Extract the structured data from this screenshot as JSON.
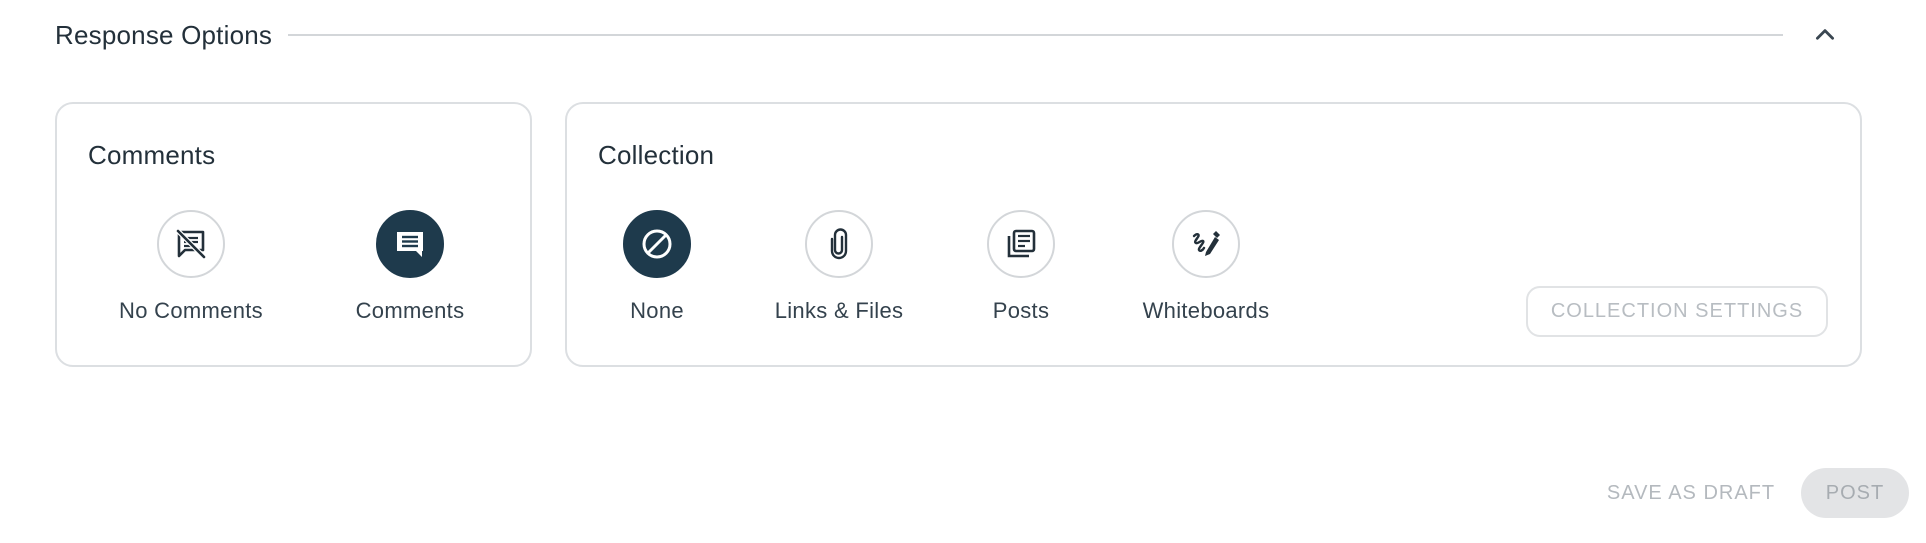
{
  "section": {
    "title": "Response Options",
    "collapse_icon": "chevron-up-icon"
  },
  "comments_card": {
    "title": "Comments",
    "options": [
      {
        "label": "No Comments",
        "icon": "no-comments-icon",
        "selected": false
      },
      {
        "label": "Comments",
        "icon": "comments-icon",
        "selected": true
      }
    ]
  },
  "collection_card": {
    "title": "Collection",
    "options": [
      {
        "label": "None",
        "icon": "none-icon",
        "selected": true
      },
      {
        "label": "Links & Files",
        "icon": "paperclip-icon",
        "selected": false
      },
      {
        "label": "Posts",
        "icon": "posts-icon",
        "selected": false
      },
      {
        "label": "Whiteboards",
        "icon": "whiteboard-icon",
        "selected": false
      }
    ],
    "settings_button": "COLLECTION SETTINGS"
  },
  "footer": {
    "save_draft": "SAVE AS DRAFT",
    "post": "POST"
  },
  "colors": {
    "accent": "#1e3a4c",
    "border": "#dcdfe2",
    "disabled_text": "#b4b9be"
  }
}
